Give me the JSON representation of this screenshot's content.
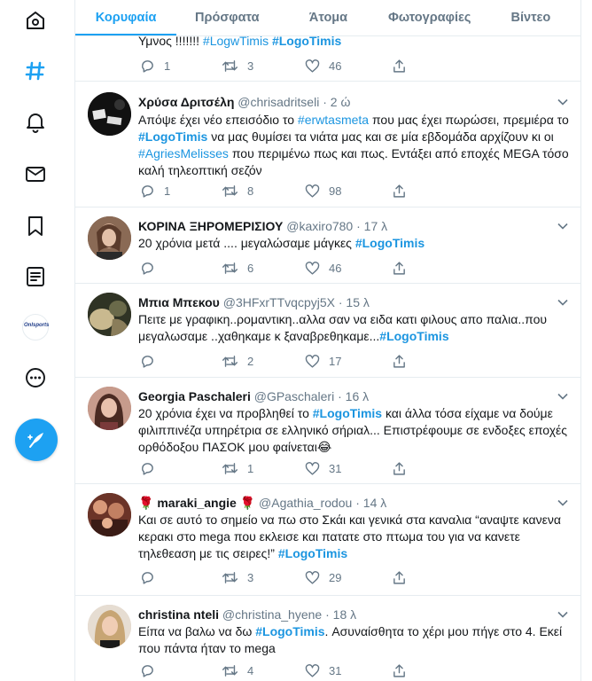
{
  "tabs": [
    "Κορυφαία",
    "Πρόσφατα",
    "Άτομα",
    "Φωτογραφίες",
    "Βίντεο"
  ],
  "sidebar": {
    "items": [
      "home-icon",
      "explore-icon",
      "notifications-icon",
      "messages-icon",
      "bookmarks-icon",
      "lists-icon",
      "profile-avatar",
      "more-icon"
    ],
    "profile_text": "Onlsports",
    "compose": "compose-icon"
  },
  "colors": {
    "accent": "#1da1f2",
    "link": "#1b95e0",
    "muted": "#657786",
    "border": "#e6ecf0"
  },
  "tweets": [
    {
      "text_parts": [
        "Υμνος !!!!!!! ",
        "#LogwTimis",
        " ",
        "#LogoTimis"
      ],
      "replies": "1",
      "retweets": "3",
      "likes": "46"
    },
    {
      "name": "Χρύσα Δριτσέλη",
      "handle": "@chrisadritseli",
      "time": "2 ώ",
      "text_parts": [
        "Απόψε έχει νέο επεισόδιο το ",
        "#erwtasmeta",
        " που μας έχει πωρώσει, πρεμιέρα το ",
        "#LogoTimis",
        " να μας θυμίσει τα νιάτα μας και σε μία εβδομάδα αρχίζουν κι οι  ",
        "#AgriesMelisses",
        " που περιμένω πως και πως. Εντάξει από εποχές MEGA τόσο καλή τηλεοπτική σεζόν"
      ],
      "replies": "1",
      "retweets": "8",
      "likes": "98"
    },
    {
      "name": "ΚΟΡΙΝΑ ΞΗΡΟΜΕΡΙΣΙΟΥ",
      "handle": "@kaxiro780",
      "time": "17 λ",
      "text_parts": [
        "20 χρόνια μετά .... μεγαλώσαμε μάγκες  ",
        "#LogoTimis"
      ],
      "replies": "",
      "retweets": "6",
      "likes": "46"
    },
    {
      "name": "Μπια Μπεκου",
      "handle": "@3HFxrTTvqcpyj5X",
      "time": "15 λ",
      "text_parts": [
        "Πειτε με γραφικη..ρομαντικη..αλλα σαν να ειδα κατι φιλους απο παλια..που μεγαλωσαμε ..χαθηκαμε κ ξαναβρεθηκαμε...",
        "#LogoTimis"
      ],
      "replies": "",
      "retweets": "2",
      "likes": "17"
    },
    {
      "name": "Georgia Paschaleri",
      "handle": "@GPaschaleri",
      "time": "16 λ",
      "text_parts": [
        "20 χρόνια έχει να προβληθεί το ",
        "#LogoTimis",
        " και άλλα τόσα είχαμε να δούμε φιλιππινέζα υπηρέτρια σε ελληνικό σήριαλ... Επιστρέφουμε σε ενδοξες εποχές ορθόδοξου ΠΑΣΟΚ μου φαίνεται",
        "😂"
      ],
      "replies": "",
      "retweets": "1",
      "likes": "31"
    },
    {
      "name": "maraki_angie",
      "name_prefix": "🌹",
      "name_suffix": "🌹",
      "handle": "@Agathia_rodou",
      "time": "14 λ",
      "text_parts": [
        "Και σε αυτό το σημείο να πω στο Σκάι και γενικά στα καναλια “αναψτε κανενα κερακι στο mega που εκλεισε και πατατε στο πτωμα του για να κανετε τηλεθεαση με τις σειρες!” ",
        "#LogoTimis"
      ],
      "replies": "",
      "retweets": "3",
      "likes": "29"
    },
    {
      "name": "christina nteli",
      "handle": "@christina_hyene",
      "time": "18 λ",
      "text_parts": [
        "Είπα να βαλω να δω ",
        "#LogoTimis",
        ". Ασυναίσθητα το χέρι μου πήγε στο 4. Εκεί που πάντα ήταν το mega"
      ],
      "replies": "",
      "retweets": "4",
      "likes": "31"
    }
  ]
}
